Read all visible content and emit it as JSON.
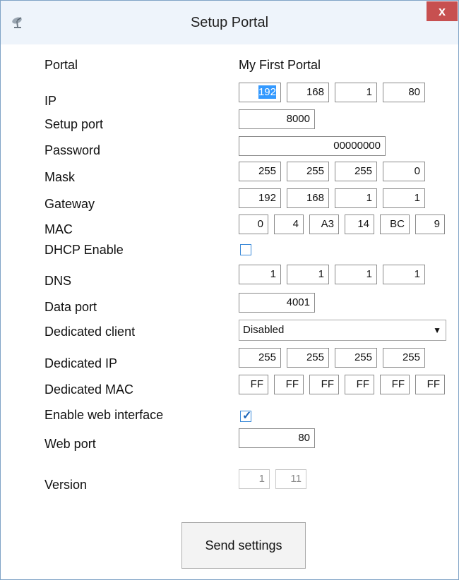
{
  "window": {
    "title": "Setup Portal",
    "close_label": "x",
    "icon": "satellite-dish-icon"
  },
  "labels": {
    "portal": "Portal",
    "ip": "IP",
    "setup_port": "Setup port",
    "password": "Password",
    "mask": "Mask",
    "gateway": "Gateway",
    "mac": "MAC",
    "dhcp_enable": "DHCP Enable",
    "dns": "DNS",
    "data_port": "Data port",
    "dedicated_client": "Dedicated client",
    "dedicated_ip": "Dedicated IP",
    "dedicated_mac": "Dedicated MAC",
    "enable_web_interface": "Enable web interface",
    "web_port": "Web port",
    "version": "Version"
  },
  "values": {
    "portal_name": "My First Portal",
    "ip": [
      "192",
      "168",
      "1",
      "80"
    ],
    "setup_port": "8000",
    "password": "00000000",
    "mask": [
      "255",
      "255",
      "255",
      "0"
    ],
    "gateway": [
      "192",
      "168",
      "1",
      "1"
    ],
    "mac": [
      "0",
      "4",
      "A3",
      "14",
      "BC",
      "9"
    ],
    "dhcp_enable": false,
    "dns": [
      "1",
      "1",
      "1",
      "1"
    ],
    "data_port": "4001",
    "dedicated_client": "Disabled",
    "dedicated_ip": [
      "255",
      "255",
      "255",
      "255"
    ],
    "dedicated_mac": [
      "FF",
      "FF",
      "FF",
      "FF",
      "FF",
      "FF"
    ],
    "enable_web_interface": true,
    "web_port": "80",
    "version": [
      "1",
      "11"
    ]
  },
  "buttons": {
    "send_settings": "Send settings"
  },
  "colors": {
    "close_button": "#c75050",
    "selection": "#3399ff",
    "checkbox_border": "#3c8ad8"
  }
}
